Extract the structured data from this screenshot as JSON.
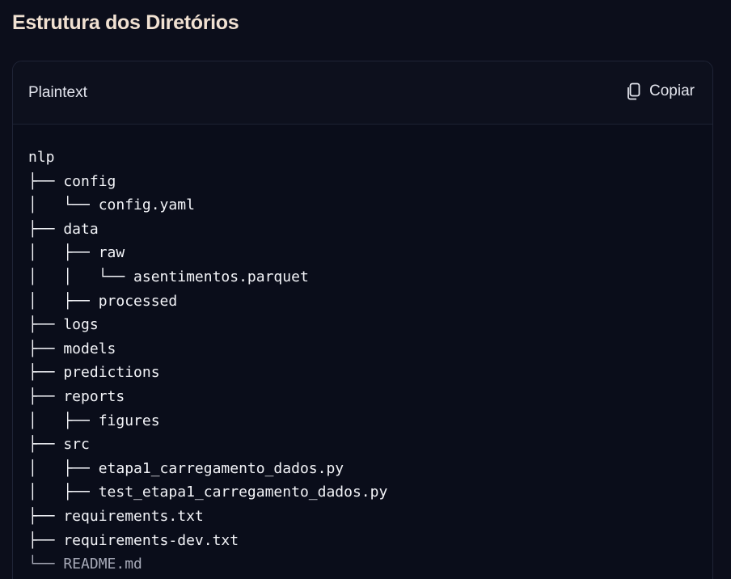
{
  "heading": "Estrutura dos Diretórios",
  "code_block": {
    "language": "Plaintext",
    "copy_label": "Copiar",
    "copy_icon": "copy-icon",
    "lines": [
      "nlp",
      "├── config",
      "│   └── config.yaml",
      "├── data",
      "│   ├── raw",
      "│   │   └── asentimentos.parquet",
      "│   ├── processed",
      "├── logs",
      "├── models",
      "├── predictions",
      "├── reports",
      "│   ├── figures",
      "├── src",
      "│   ├── etapa1_carregamento_dados.py",
      "│   ├── test_etapa1_carregamento_dados.py",
      "├── requirements.txt",
      "├── requirements-dev.txt",
      "└── README.md"
    ]
  },
  "colors": {
    "background": "#0c0e1b",
    "heading_text": "#f1e1d2",
    "code_text": "#f3f4f8"
  }
}
